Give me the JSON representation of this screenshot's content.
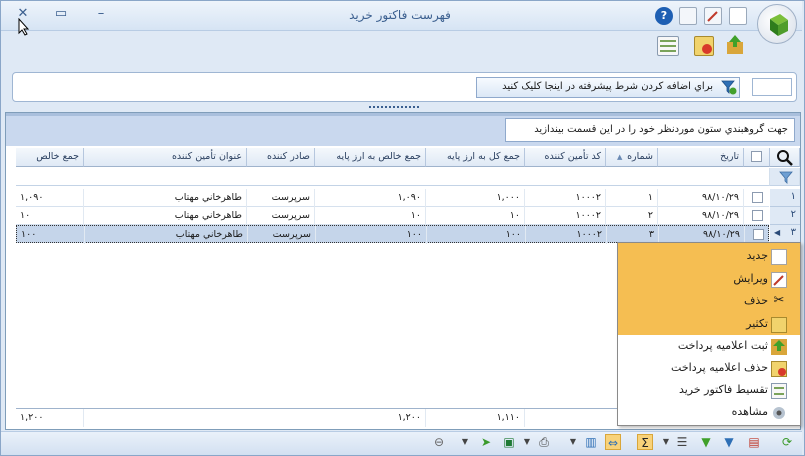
{
  "window": {
    "title": "فهرست فاكتور خريد"
  },
  "filter": {
    "button_label": "براي اضافه کردن شرط پيشرفته در اينجا کليک کنيد"
  },
  "group_hint": "جهت گروهبندي ستون موردنظر خود را در اين قسمت بيندازيد",
  "columns": [
    "تاريخ",
    "شماره",
    "کد تأمين کننده",
    "جمع کل به ارز پايه",
    "جمع خالص به ارز پايه",
    "صادر کننده",
    "عنوان تأمين کننده",
    "جمع خالص"
  ],
  "rows": [
    {
      "index": "١",
      "date": "٩٨/١٠/٢٩",
      "number": "١",
      "supplier_code": "١٠٠٠٢",
      "total": "١,٠٠٠",
      "net_total": "١,٠٩٠",
      "issuer": "سرپرست",
      "supplier": "طاهرخاني مهتاب",
      "net": "١,٠٩٠"
    },
    {
      "index": "٢",
      "date": "٩٨/١٠/٢٩",
      "number": "٢",
      "supplier_code": "١٠٠٠٢",
      "total": "١٠",
      "net_total": "١٠",
      "issuer": "سرپرست",
      "supplier": "طاهرخاني مهتاب",
      "net": "١٠"
    },
    {
      "index": "٣",
      "date": "٩٨/١٠/٢٩",
      "number": "٣",
      "supplier_code": "١٠٠٠٢",
      "total": "١٠٠",
      "net_total": "١٠٠",
      "issuer": "سرپرست",
      "supplier": "طاهرخاني مهتاب",
      "net": "١٠٠"
    }
  ],
  "footer": {
    "total": "١,١١٠",
    "net_total": "١,٢٠٠",
    "net": "١,٢٠٠"
  },
  "context_menu": {
    "items": [
      "جديد",
      "ويرايش",
      "حذف",
      "تکثير",
      "ثبت اعلاميه پرداخت",
      "حذف اعلاميه پرداخت",
      "تقسيط فاکتور خريد",
      "مشاهده"
    ]
  },
  "colors": {
    "highlight": "#f5be52",
    "selected_row": "#c5d5ea",
    "header_bg": "#dfe9f5"
  }
}
